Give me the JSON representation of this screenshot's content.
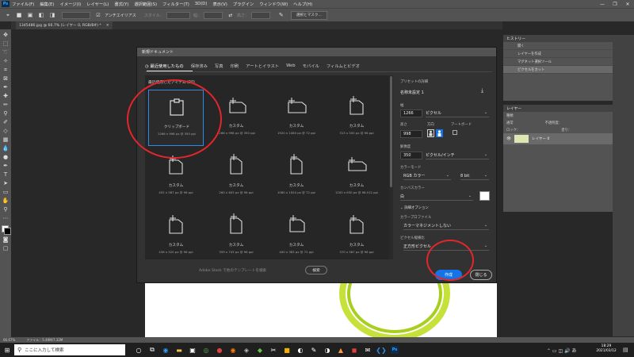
{
  "menubar": {
    "app_icon": "Ps",
    "items": [
      "ファイル(F)",
      "編集(E)",
      "イメージ(I)",
      "レイヤー(L)",
      "書式(Y)",
      "選択範囲(S)",
      "フィルター(T)",
      "3D(D)",
      "表示(V)",
      "プラグイン",
      "ウィンドウ(W)",
      "ヘルプ(H)"
    ],
    "window_controls": [
      "—",
      "❐",
      "✕"
    ]
  },
  "options_bar": {
    "antialias_label": "アンチエイリアス",
    "style_label": "スタイル：",
    "width_label": "幅：",
    "height_label": "高さ：",
    "select_mask_label": "選択とマスク..."
  },
  "document_tab": {
    "label": "1345486.jpg @ 66.7% (レイヤー 0, RGB/8#) *",
    "close": "✕"
  },
  "status_bar": {
    "zoom": "66.67%",
    "file_info": "ファイル：5.49M/7.32M"
  },
  "history_panel": {
    "title": "ヒストリー",
    "items": [
      "開く",
      "レイヤーを作成",
      "マグネット選択ツール",
      "ピクセルをカット"
    ]
  },
  "layers_panel": {
    "title": "レイヤー",
    "search_placeholder": "種類",
    "mode": "通常",
    "opacity_label": "不透明度：",
    "lock_label": "ロック：",
    "fill_label": "塗り：",
    "layer_name": "レイヤー 0"
  },
  "dialog": {
    "title": "新規ドキュメント",
    "tabs": [
      "最近使用したもの",
      "保存済み",
      "写真",
      "印刷",
      "アートとイラスト",
      "Web",
      "モバイル",
      "フィルムとビデオ"
    ],
    "recent_heading": "最近使用したアイテム (20)",
    "presets": [
      {
        "name": "クリップボード",
        "size": "1266 x 998 px @ 350 ppi"
      },
      {
        "name": "カスタム",
        "size": "1266 x 998 px @ 350 ppi"
      },
      {
        "name": "カスタム",
        "size": "1920 x 1080 px @ 72 ppi"
      },
      {
        "name": "カスタム",
        "size": "313 x 500 px @ 96 ppi"
      },
      {
        "name": "カスタム",
        "size": "452 x 587 px @ 96 ppi"
      },
      {
        "name": "カスタム",
        "size": "260 x 603 px @ 96 ppi"
      },
      {
        "name": "カスタム",
        "size": "1080 x 1920 px @ 72 ppi"
      },
      {
        "name": "カスタム",
        "size": "1200 x 630 px @ 96.012 ppi"
      },
      {
        "name": "カスタム",
        "size": "436 x 520 px @ 96 ppi"
      },
      {
        "name": "カスタム",
        "size": "359 x 743 px @ 96 ppi"
      },
      {
        "name": "カスタム",
        "size": "400 x 383 px @ 72 ppi"
      },
      {
        "name": "カスタム",
        "size": "370 x 587 px @ 96 ppi"
      }
    ],
    "stock_search_placeholder": "Adobe Stock で他のテンプレートを検索",
    "search_button": "検索",
    "details": {
      "heading": "プリセットの詳細",
      "name": "名称未設定 1",
      "width_label": "幅",
      "width_value": "1266",
      "width_unit": "ピクセル",
      "height_label": "高さ",
      "height_value": "998",
      "orientation_label": "方向",
      "artboard_label": "アートボード",
      "resolution_label": "解像度",
      "resolution_value": "350",
      "resolution_unit": "ピクセル/インチ",
      "color_mode_label": "カラーモード",
      "color_mode_value": "RGB カラー",
      "bit_depth": "8 bit",
      "bg_label": "カンバスカラー",
      "bg_value": "白",
      "advanced_label": "詳細オプション",
      "profile_label": "カラープロファイル",
      "profile_value": "カラーマネジメントしない",
      "pixel_aspect_label": "ピクセル縦横比",
      "pixel_aspect_value": "正方形ピクセル"
    },
    "create_button": "作成",
    "close_button": "閉じる"
  },
  "taskbar": {
    "search_placeholder": "ここに入力して検索",
    "clock_time": "18:29",
    "clock_date": "2021/03/12"
  },
  "colors": {
    "accent_blue": "#1473e6",
    "annotation_red": "#e3262b",
    "selection_blue": "#2d8ceb"
  }
}
